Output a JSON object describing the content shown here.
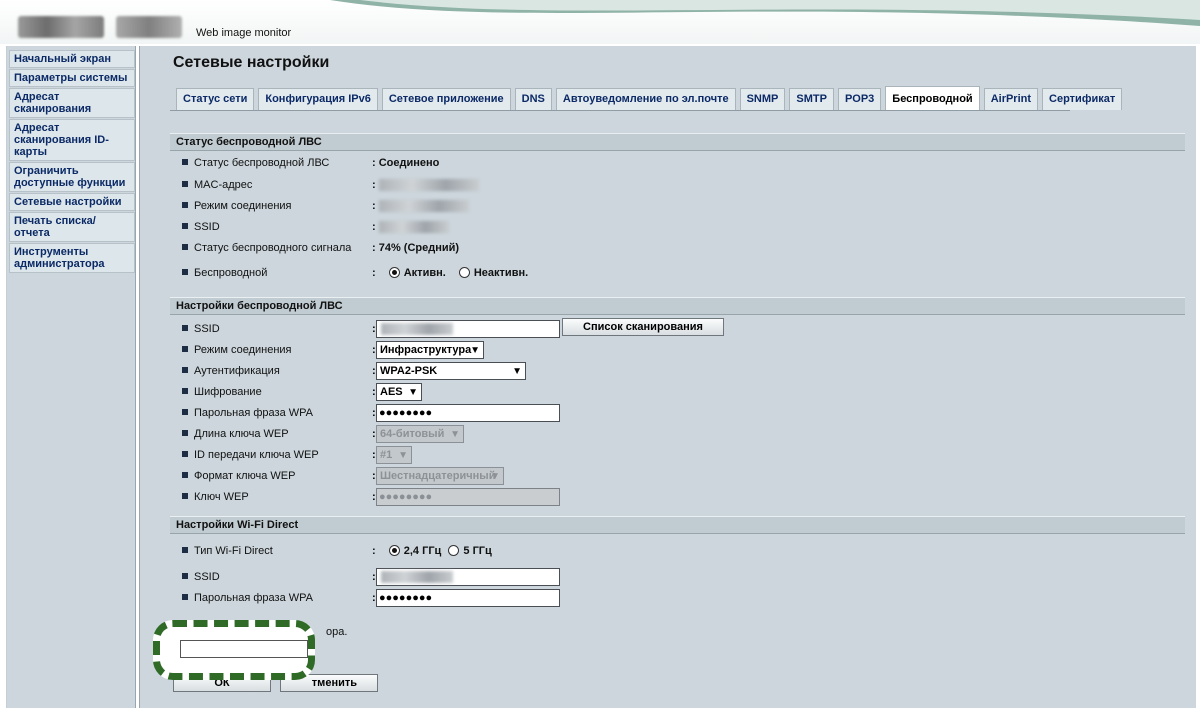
{
  "header": {
    "app_title": "Web image monitor"
  },
  "sidebar": {
    "items": [
      "Начальный экран",
      "Параметры системы",
      "Адресат сканирования",
      "Адресат сканирования ID-карты",
      "Ограничить доступные функции",
      "Сетевые настройки",
      "Печать списка/отчета",
      "Инструменты администратора"
    ]
  },
  "page": {
    "title": "Сетевые настройки"
  },
  "tabs": [
    "Статус сети",
    "Конфигурация IPv6",
    "Сетевое приложение",
    "DNS",
    "Автоуведомление по эл.почте",
    "SNMP",
    "SMTP",
    "POP3",
    "Беспроводной",
    "AirPrint",
    "Сертификат"
  ],
  "active_tab": "Беспроводной",
  "wlan_status": {
    "heading": "Статус беспроводной ЛВС",
    "status_label": "Статус беспроводной ЛВС",
    "status_value": ": Соединено",
    "mac_label": "MAC-адрес",
    "mode_label": "Режим соединения",
    "ssid_label": "SSID",
    "signal_label": "Статус беспроводного сигнала",
    "signal_value": ": 74% (Средний)",
    "wireless_label": "Беспроводной",
    "opt_active": "Активн.",
    "opt_inactive": "Неактивн."
  },
  "wlan_settings": {
    "heading": "Настройки беспроводной ЛВС",
    "ssid_label": "SSID",
    "scan_button": "Список сканирования",
    "mode_label": "Режим соединения",
    "mode_value": "Инфраструктура",
    "auth_label": "Аутентификация",
    "auth_value": "WPA2-PSK",
    "enc_label": "Шифрование",
    "enc_value": "AES",
    "wpa_label": "Парольная фраза WPA",
    "wpa_value": "●●●●●●●●",
    "wep_len_label": "Длина ключа WEP",
    "wep_len_value": "64-битовый",
    "wep_id_label": "ID передачи ключа WEP",
    "wep_id_value": "#1",
    "wep_fmt_label": "Формат ключа WEP",
    "wep_fmt_value": "Шестнадцатеричный",
    "wep_key_label": "Ключ WEP",
    "wep_key_value": "●●●●●●●●"
  },
  "wifi_direct": {
    "heading": "Настройки Wi-Fi Direct",
    "type_label": "Тип Wi-Fi Direct",
    "opt_24": "2,4 ГГц",
    "opt_5": "5 ГГц",
    "ssid_label": "SSID",
    "wpa_label": "Парольная фраза WPA",
    "wpa_value": "●●●●●●●●"
  },
  "footer": {
    "note_fragment": "ора.",
    "ok_fragment": "ОК",
    "cancel_fragment": "тменить"
  },
  "colors": {
    "link": "#0b2a66",
    "highlight": "#2f6a27",
    "panel": "#ccd6dc"
  }
}
